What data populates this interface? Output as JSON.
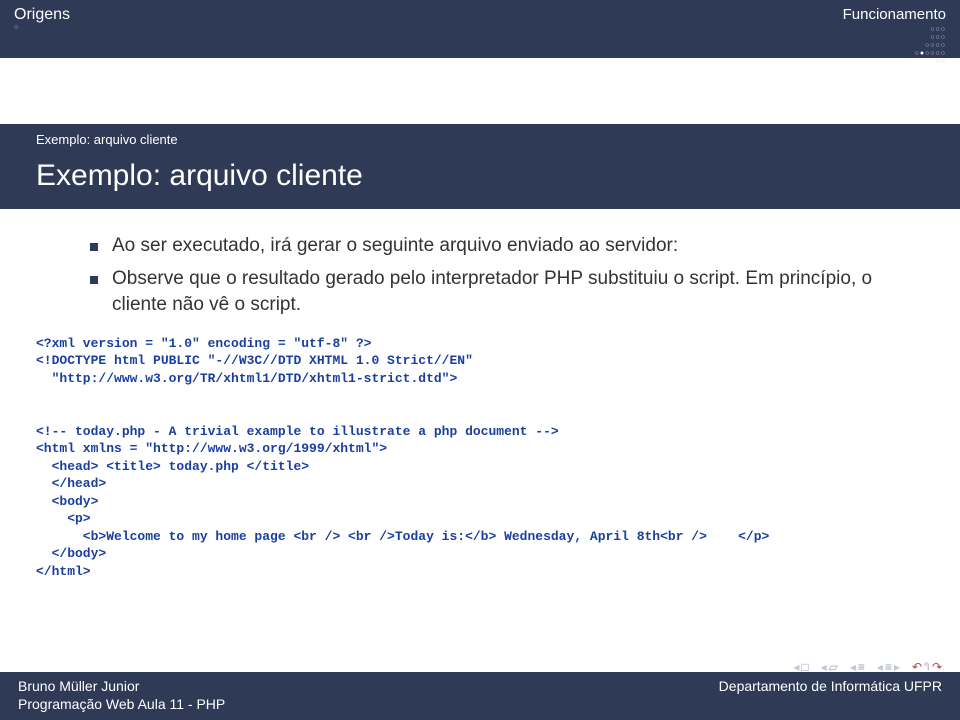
{
  "header": {
    "nav_left": "Origens",
    "nav_right": "Funcionamento"
  },
  "section": {
    "label": "Exemplo: arquivo cliente",
    "title": "Exemplo: arquivo cliente"
  },
  "bullets": [
    "Ao ser executado, irá gerar o seguinte arquivo enviado ao servidor:",
    "Observe que o resultado gerado pelo interpretador PHP substituiu o script. Em princípio, o cliente não vê o script."
  ],
  "code": {
    "l1": "<?xml version = \"1.0\" encoding = \"utf-8\" ?>",
    "l2": "<!DOCTYPE html PUBLIC \"-//W3C//DTD XHTML 1.0 Strict//EN\"",
    "l3": "  \"http://www.w3.org/TR/xhtml1/DTD/xhtml1-strict.dtd\">",
    "blank1": "",
    "blank2": "",
    "l4": "<!-- today.php - A trivial example to illustrate a php document -->",
    "l5": "<html xmlns = \"http://www.w3.org/1999/xhtml\">",
    "l6": "  <head> <title> today.php </title>",
    "l7": "  </head>",
    "l8": "  <body>",
    "l9": "    <p>",
    "l10": "      <b>Welcome to my home page <br /> <br />Today is:</b> Wednesday, April 8th<br />    </p>",
    "l11": "  </body>",
    "l12": "</html>"
  },
  "footer": {
    "author": "Bruno Müller Junior",
    "dept": "Departamento de Informática   UFPR",
    "course": "Programação Web   Aula 11 - PHP"
  }
}
